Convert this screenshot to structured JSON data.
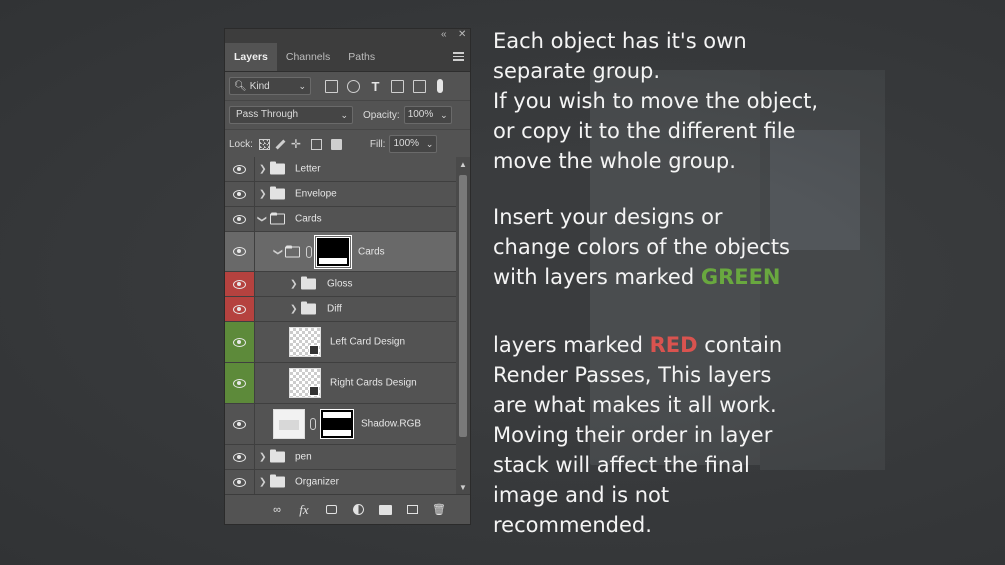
{
  "panel": {
    "tabs": [
      "Layers",
      "Channels",
      "Paths"
    ],
    "filter": {
      "kind_label": "Kind"
    },
    "blend_mode": "Pass Through",
    "opacity_label": "Opacity:",
    "opacity_value": "100%",
    "lock_label": "Lock:",
    "fill_label": "Fill:",
    "fill_value": "100%",
    "layers": [
      {
        "name": "Letter",
        "type": "group",
        "marker": "none"
      },
      {
        "name": "Envelope",
        "type": "group",
        "marker": "none"
      },
      {
        "name": "Cards",
        "type": "group-open",
        "marker": "none"
      },
      {
        "name": "Cards",
        "type": "group-masked",
        "marker": "none",
        "selected": true
      },
      {
        "name": "Gloss",
        "type": "group",
        "marker": "red"
      },
      {
        "name": "Diff",
        "type": "group",
        "marker": "red"
      },
      {
        "name": "Left Card Design",
        "type": "smart-object",
        "marker": "green"
      },
      {
        "name": "Right Cards Design",
        "type": "smart-object",
        "marker": "green"
      },
      {
        "name": "Shadow.RGB",
        "type": "masked-layer",
        "marker": "none"
      },
      {
        "name": "pen",
        "type": "group",
        "marker": "none"
      },
      {
        "name": "Organizer",
        "type": "group",
        "marker": "none"
      }
    ],
    "footer_icons": [
      "link-icon",
      "fx-icon",
      "mask-icon",
      "adjustment-icon",
      "new-group-icon",
      "new-layer-icon",
      "trash-icon"
    ]
  },
  "notes": {
    "para1_lines": [
      "Each object has it's own",
      "separate group.",
      "If you wish to move the object,",
      "or copy it to the different file",
      "move the whole group."
    ],
    "para2_lines": [
      "Insert your designs or",
      "change colors of the objects"
    ],
    "para2_last_prefix": "with layers marked ",
    "para2_keyword": "GREEN",
    "para3_first_prefix": "layers marked ",
    "para3_keyword": "RED",
    "para3_first_suffix": " contain",
    "para3_lines": [
      "Render Passes, This layers",
      "are what makes it all work.",
      "Moving their order in layer",
      "stack will affect the final",
      "image and is not",
      "recommended."
    ]
  },
  "colors": {
    "green_marker": "#5d8a3a",
    "red_marker": "#b5423f",
    "green_text": "#69a83f",
    "red_text": "#d9534f"
  }
}
